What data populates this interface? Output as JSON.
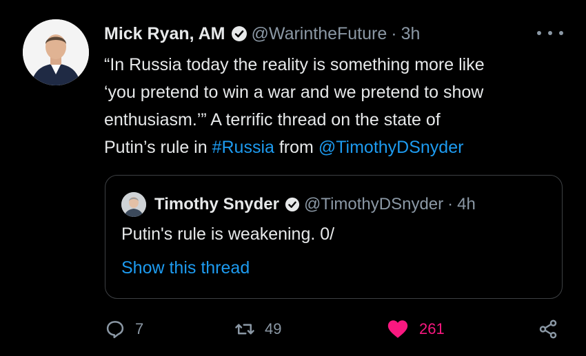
{
  "tweet": {
    "author_name": "Mick Ryan, AM",
    "handle": "@WarintheFuture",
    "separator": "·",
    "time": "3h",
    "text_lines": [
      "“In Russia today the reality is something more like",
      "‘you pretend to win a war and we pretend to show",
      "enthusiasm.’” A terrific thread on the state of"
    ],
    "last_line": {
      "prefix": "Putin’s rule in ",
      "hashtag": "#Russia",
      "middle": " from ",
      "mention": "@TimothyDSnyder"
    }
  },
  "quote": {
    "author_name": "Timothy Snyder",
    "handle": "@TimothyDSnyder",
    "separator": "·",
    "time": "4h",
    "text": "Putin's rule is weakening. 0/",
    "show_thread": "Show this thread"
  },
  "actions": {
    "replies": "7",
    "retweets": "49",
    "likes": "261"
  },
  "colors": {
    "background": "#000000",
    "link": "#1d9bf0",
    "like": "#f91880",
    "muted": "#8b98a5"
  },
  "icons": {
    "verified": "verified-badge-icon",
    "more": "more-dots-icon",
    "reply": "reply-icon",
    "retweet": "retweet-icon",
    "like": "heart-icon",
    "share": "share-icon"
  }
}
